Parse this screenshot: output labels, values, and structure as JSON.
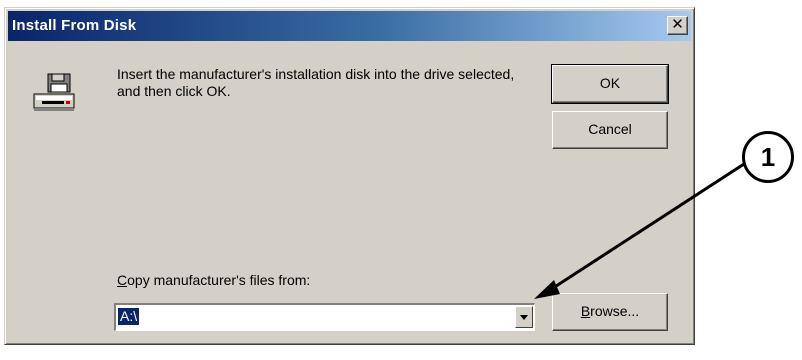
{
  "window": {
    "title": "Install From Disk",
    "close_label": "✕"
  },
  "message": "Insert the manufacturer's installation disk into the drive selected, and then click OK.",
  "buttons": {
    "ok": "OK",
    "cancel": "Cancel",
    "browse": "Browse..."
  },
  "copy_from": {
    "label": "Copy manufacturer's files from:",
    "value": "A:\\"
  },
  "callout": {
    "number": "1"
  },
  "icons": {
    "disk": "floppy-drive-icon",
    "dropdown": "dropdown-arrow-icon"
  }
}
